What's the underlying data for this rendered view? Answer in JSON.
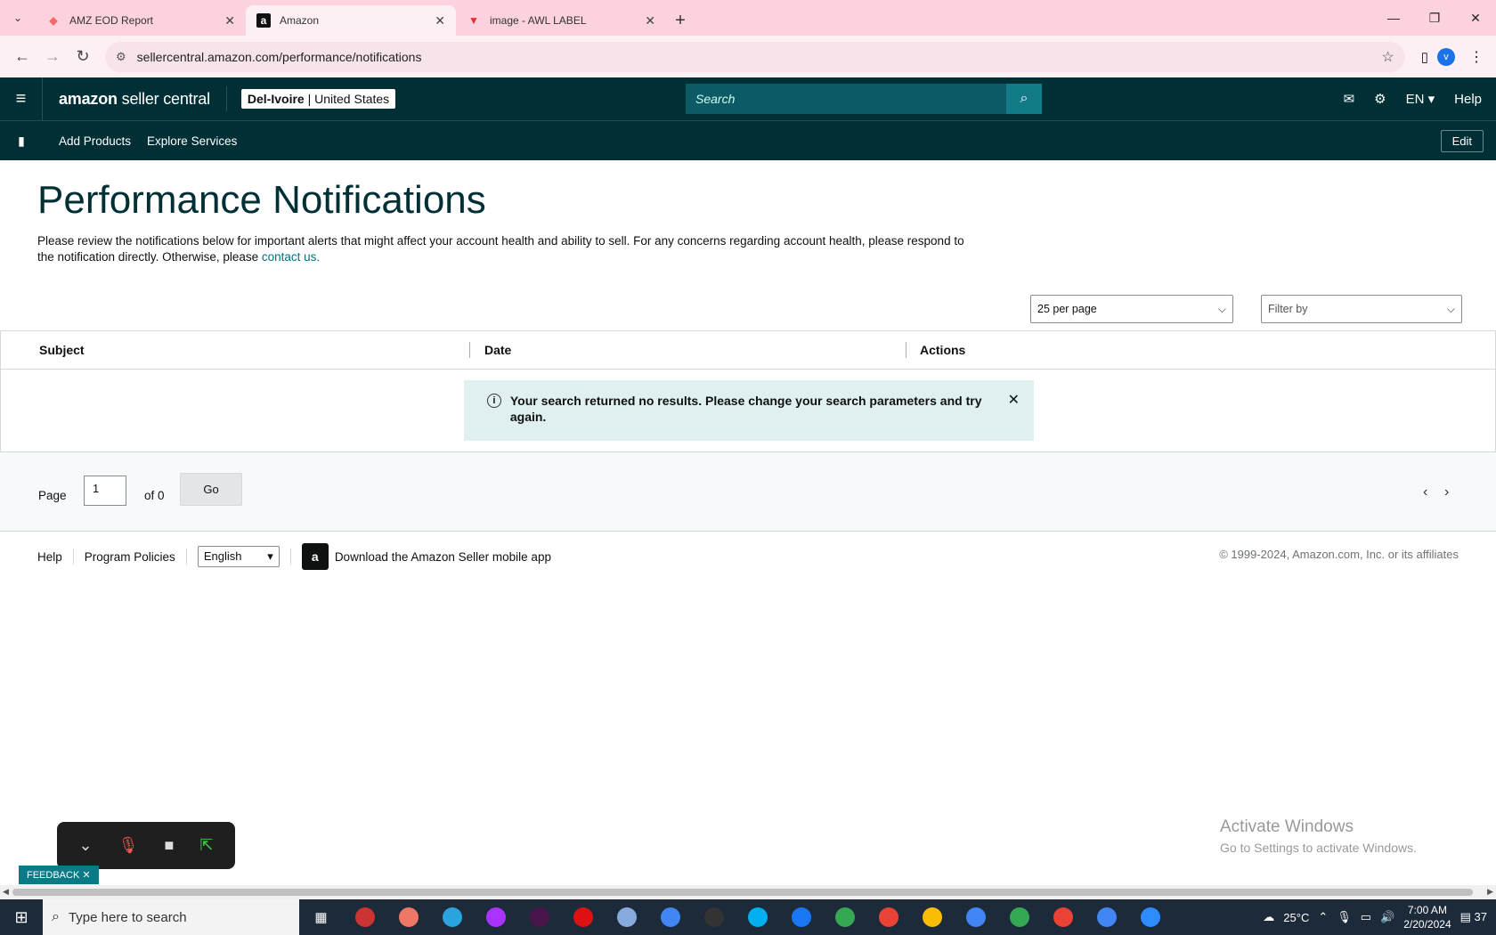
{
  "browser": {
    "tabs": [
      {
        "title": "AMZ EOD Report",
        "icon": "asana-icon"
      },
      {
        "title": "Amazon",
        "icon": "amazon-icon"
      },
      {
        "title": "image - AWL LABEL",
        "icon": "label-icon"
      }
    ],
    "url": "sellercentral.amazon.com/performance/notifications",
    "profile_initial": "v"
  },
  "header": {
    "logo_bold": "amazon",
    "logo_rest": "seller central",
    "account_name": "Del-Ivoire",
    "marketplace": "United States",
    "search_placeholder": "Search",
    "lang": "EN",
    "help": "Help"
  },
  "subnav": {
    "links": [
      "Add Products",
      "Explore Services"
    ],
    "edit": "Edit"
  },
  "main": {
    "title": "Performance Notifications",
    "desc_text": "Please review the notifications below for important alerts that might affect your account health and ability to sell. For any concerns regarding account health, please respond to the notification directly. Otherwise, please",
    "desc_link": "contact us.",
    "per_page": "25 per page",
    "filter_placeholder": "Filter by",
    "columns": [
      "Subject",
      "Date",
      "Actions"
    ],
    "alert": "Your search returned no results. Please change your search parameters and try again.",
    "pager": {
      "page_label": "Page",
      "page_value": "1",
      "of_label": "of 0",
      "go": "Go"
    }
  },
  "footer": {
    "help": "Help",
    "policies": "Program Policies",
    "language": "English",
    "app_text": "Download the Amazon Seller mobile app",
    "copyright": "© 1999-2024, Amazon.com, Inc. or its affiliates"
  },
  "overlay": {
    "activate_title": "Activate Windows",
    "activate_sub": "Go to Settings to activate Windows.",
    "feedback": "FEEDBACK"
  },
  "taskbar": {
    "search_placeholder": "Type here to search",
    "weather": "25°C",
    "time": "7:00 AM",
    "date": "2/20/2024",
    "notifications": "37"
  },
  "colors": {
    "header_bg": "#002f36",
    "link": "#007185",
    "alert_bg": "#e0f0f0",
    "tabstrip": "#fbd2de"
  }
}
